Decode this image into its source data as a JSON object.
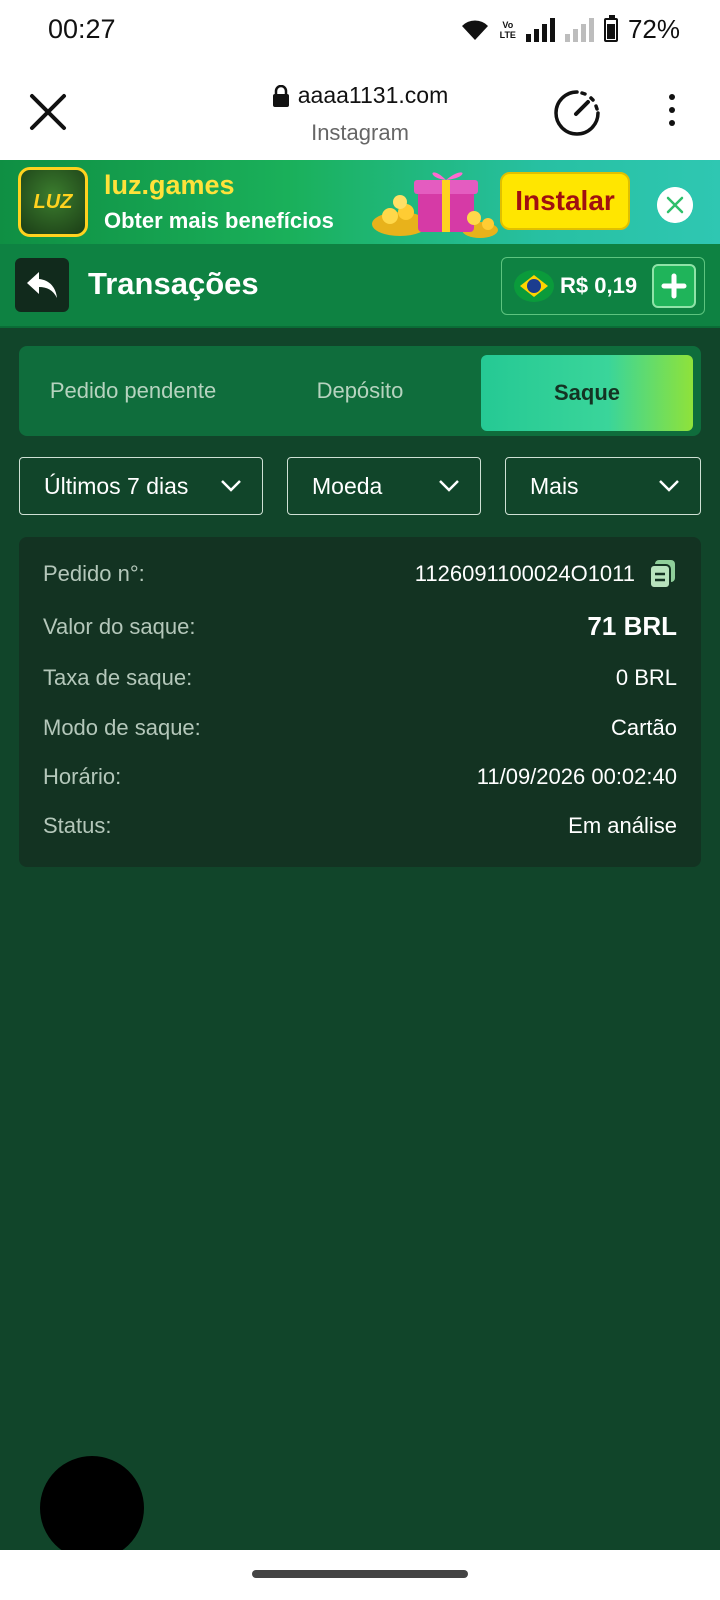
{
  "status_bar": {
    "time": "00:27",
    "volte_line1": "Vo",
    "volte_line2": "LTE",
    "battery": "72%",
    "battery_level": 0.72
  },
  "browser": {
    "url": "aaaa1131.com",
    "subtitle": "Instagram",
    "icons": [
      "close-icon",
      "lock-icon",
      "speed-icon",
      "more-vert-icon"
    ]
  },
  "ad": {
    "logo_text": "LUZ",
    "title": "luz.games",
    "subtitle": "Obter mais benefícios",
    "install_label": "Instalar",
    "colors": {
      "install_bg": "#ffe600",
      "install_text": "#a01010",
      "title": "#ffe23a"
    }
  },
  "header": {
    "title": "Transações",
    "balance": "R$ 0,19"
  },
  "tabs": [
    {
      "label": "Pedido pendente",
      "active": false
    },
    {
      "label": "Depósito",
      "active": false
    },
    {
      "label": "Saque",
      "active": true
    }
  ],
  "filters": {
    "period": "Últimos 7 dias",
    "currency": "Moeda",
    "more": "Mais"
  },
  "transaction": {
    "order_label": "Pedido n°:",
    "order_value": "1126091100024O1011",
    "amount_label": "Valor do saque:",
    "amount_value": "71 BRL",
    "fee_label": "Taxa de saque:",
    "fee_value": "0 BRL",
    "mode_label": "Modo de saque:",
    "mode_value": "Cartão",
    "time_label": "Horário:",
    "time_value": "11/09/2026 00:02:40",
    "status_label": "Status:",
    "status_value": "Em análise"
  },
  "colors": {
    "app_bg": "#11452a",
    "header_bg": "#0e8242",
    "card_bg": "#133322",
    "accent": "#3ad59a"
  }
}
